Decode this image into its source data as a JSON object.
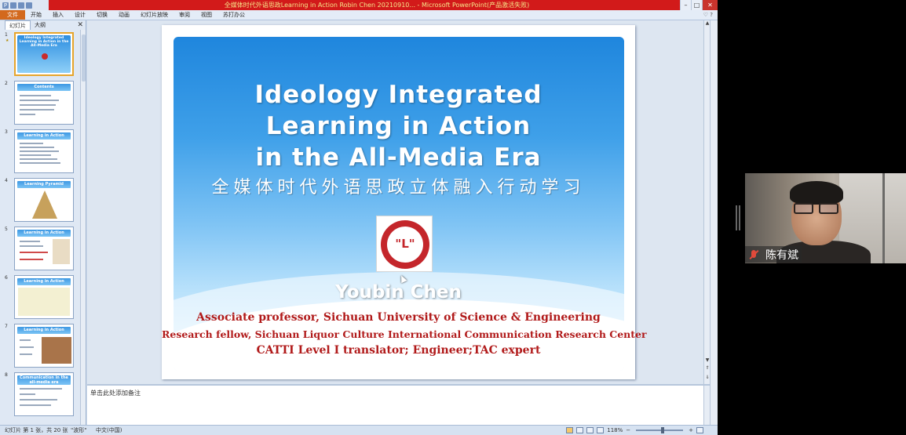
{
  "window": {
    "title": "全媒体时代外语思政Learning in Action Robin Chen 20210910... - Microsoft PowerPoint(产品激活失败)"
  },
  "ribbon": {
    "tabs": [
      "文件",
      "开始",
      "插入",
      "设计",
      "切换",
      "动画",
      "幻灯片放映",
      "审阅",
      "视图",
      "苏打办公"
    ]
  },
  "slide_pane": {
    "tabs": [
      "幻灯片",
      "大纲"
    ],
    "thumbnails": [
      {
        "number": "1",
        "title": "Ideology Integrated Learning in Action in the All-Media Era"
      },
      {
        "number": "2",
        "title": "Contents"
      },
      {
        "number": "3",
        "title": "Learning in Action"
      },
      {
        "number": "4",
        "title": "Learning Pyramid"
      },
      {
        "number": "5",
        "title": "Learning in Action"
      },
      {
        "number": "6",
        "title": "Learning in Action"
      },
      {
        "number": "7",
        "title": "Learning in Action"
      },
      {
        "number": "8",
        "title": "Communication in the all-media era"
      }
    ]
  },
  "slide": {
    "title_lines": [
      "Ideology Integrated",
      "Learning in Action",
      "in the All-Media Era"
    ],
    "subtitle": "全媒体时代外语思政立体融入行动学习",
    "logo_mark": "\"L\"",
    "author": "Youbin Chen",
    "affiliations": [
      "Associate professor, Sichuan University of Science & Engineering",
      "Research fellow, Sichuan Liquor Culture International Communication Research Center",
      "CATTI Level I translator; Engineer;TAC expert"
    ]
  },
  "notes": {
    "placeholder": "单击此处添加备注"
  },
  "status": {
    "slide_info": "幻灯片 第 1 张，共 20 张",
    "theme": "\"波形\"",
    "language": "中文(中国)",
    "zoom": "118%"
  },
  "video": {
    "participant_name": "陈有斌"
  }
}
